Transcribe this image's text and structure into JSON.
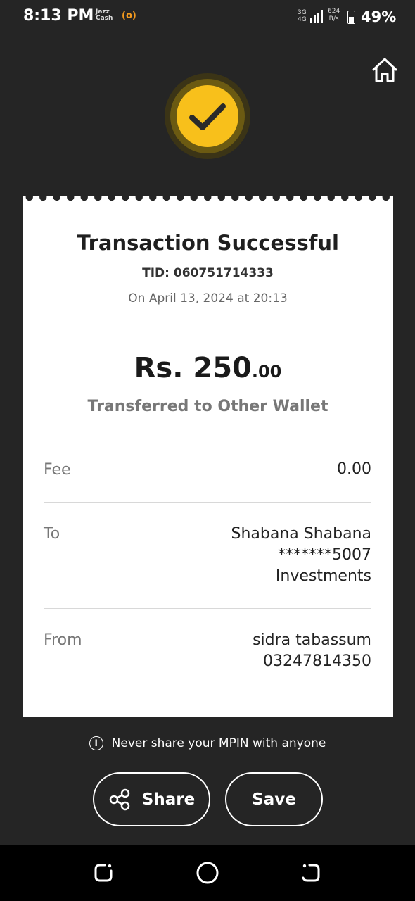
{
  "status_bar": {
    "time": "8:13 PM",
    "app_badge_line1": "Jazz",
    "app_badge_line2": "Cash",
    "hotspot_glyph": "(o)",
    "network_line1": "3G",
    "network_line2": "4G",
    "speed_value": "624",
    "speed_unit": "B/s",
    "battery": "49%"
  },
  "icons": {
    "home": "home-icon",
    "success": "check-icon",
    "info": "info-icon",
    "share": "share-icon"
  },
  "receipt": {
    "title": "Transaction Successful",
    "tid": "TID: 060751714333",
    "date": "On April 13, 2024 at 20:13",
    "amount_main": "Rs. 250",
    "amount_decimal": ".00",
    "transfer_type": "Transferred to Other Wallet",
    "fee": {
      "label": "Fee",
      "value": "0.00"
    },
    "to": {
      "label": "To",
      "name": "Shabana Shabana",
      "account": "*******5007",
      "detail": "Investments"
    },
    "from": {
      "label": "From",
      "name": "sidra tabassum",
      "account": "03247814350"
    }
  },
  "notice": {
    "info_glyph": "i",
    "text": "Never share your MPIN with anyone"
  },
  "actions": {
    "share_label": "Share",
    "save_label": "Save"
  },
  "colors": {
    "accent": "#f8c01b",
    "background": "#252525",
    "card": "#ffffff"
  }
}
